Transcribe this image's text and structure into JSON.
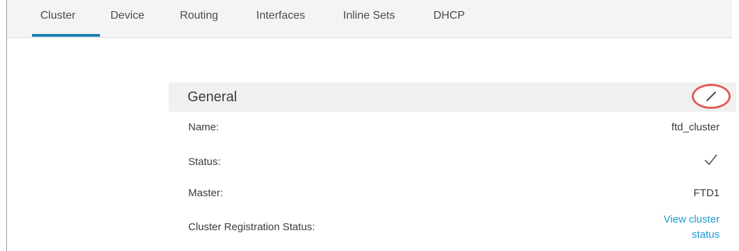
{
  "tabs": [
    {
      "label": "Cluster",
      "active": true
    },
    {
      "label": "Device",
      "active": false
    },
    {
      "label": "Routing",
      "active": false
    },
    {
      "label": "Interfaces",
      "active": false
    },
    {
      "label": "Inline Sets",
      "active": false
    },
    {
      "label": "DHCP",
      "active": false
    }
  ],
  "general": {
    "title": "General",
    "edit_icon": "pencil-icon",
    "highlight_color": "#e25b52",
    "rows": [
      {
        "label": "Name:",
        "value": "ftd_cluster"
      },
      {
        "label": "Status:",
        "value_icon": "checkmark-icon"
      },
      {
        "label": "Master:",
        "value": "FTD1"
      },
      {
        "label": "Cluster Registration Status:",
        "link": "View cluster status"
      }
    ]
  },
  "colors": {
    "accent": "#1e7fb5",
    "link": "#1a9bd7"
  }
}
